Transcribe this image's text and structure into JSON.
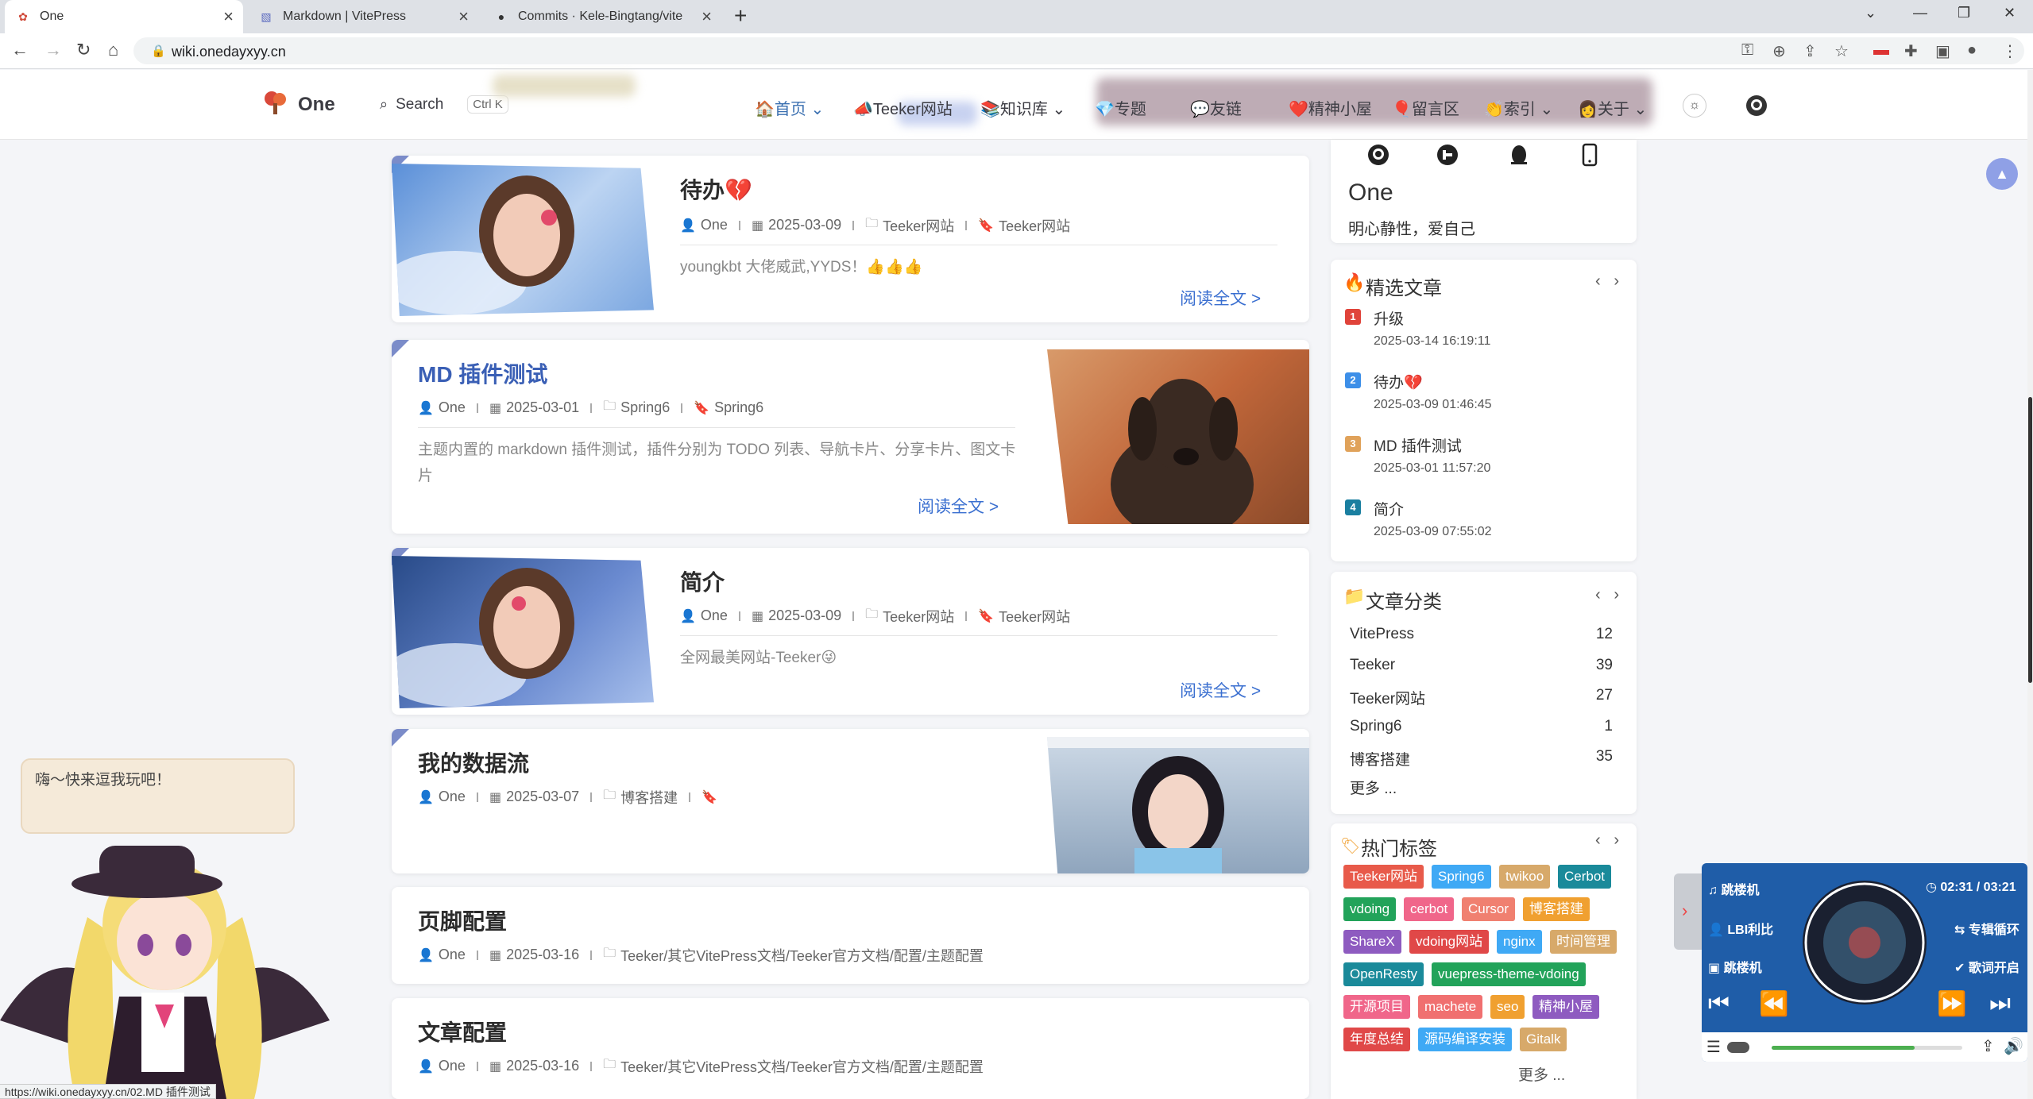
{
  "browser": {
    "tabs": [
      {
        "title": "One",
        "active": true
      },
      {
        "title": "Markdown | VitePress",
        "active": false
      },
      {
        "title": "Commits · Kele-Bingtang/vite",
        "active": false
      }
    ],
    "url": "wiki.onedayxyy.cn",
    "status_url": "https://wiki.onedayxyy.cn/02.MD 插件测试"
  },
  "header": {
    "site_name": "One",
    "search_label": "Search",
    "search_shortcut": "Ctrl K",
    "nav": [
      "首页",
      "Teeker网站",
      "知识库",
      "专题",
      "友链",
      "精神小屋",
      "留言区",
      "索引",
      "关于"
    ]
  },
  "posts": [
    {
      "title": "待办💔",
      "author": "One",
      "date": "2025-03-09",
      "category": "Teeker网站",
      "tag": "Teeker网站",
      "excerpt": "youngkbt 大佬威武,YYDS！👍👍👍",
      "read_more": "阅读全文 >"
    },
    {
      "title": "MD 插件测试",
      "author": "One",
      "date": "2025-03-01",
      "category": "Spring6",
      "tag": "Spring6",
      "excerpt": "主题内置的 markdown 插件测试，插件分别为 TODO 列表、导航卡片、分享卡片、图文卡片",
      "read_more": "阅读全文 >"
    },
    {
      "title": "简介",
      "author": "One",
      "date": "2025-03-09",
      "category": "Teeker网站",
      "tag": "Teeker网站",
      "excerpt": "全网最美网站-Teeker😜",
      "read_more": "阅读全文 >"
    },
    {
      "title": "我的数据流",
      "author": "One",
      "date": "2025-03-07",
      "category": "博客搭建",
      "tag": ""
    },
    {
      "title": "页脚配置",
      "author": "One",
      "date": "2025-03-16",
      "category": "Teeker/其它VitePress文档/Teeker官方文档/配置/主题配置"
    },
    {
      "title": "文章配置",
      "author": "One",
      "date": "2025-03-16",
      "category": "Teeker/其它VitePress文档/Teeker官方文档/配置/主题配置"
    }
  ],
  "profile": {
    "name": "One",
    "motto": "明心静性，爱自己"
  },
  "featured": {
    "title": "精选文章",
    "items": [
      {
        "rank": "1",
        "title": "升级",
        "date": "2025-03-14 16:19:11",
        "color": "#e0433a"
      },
      {
        "rank": "2",
        "title": "待办💔",
        "date": "2025-03-09 01:46:45",
        "color": "#3d8fe8"
      },
      {
        "rank": "3",
        "title": "MD 插件测试",
        "date": "2025-03-01 11:57:20",
        "color": "#e0a25a"
      },
      {
        "rank": "4",
        "title": "简介",
        "date": "2025-03-09 07:55:02",
        "color": "#1a7fa0"
      }
    ]
  },
  "categories": {
    "title": "文章分类",
    "items": [
      {
        "name": "VitePress",
        "count": "12"
      },
      {
        "name": "Teeker",
        "count": "39"
      },
      {
        "name": "Teeker网站",
        "count": "27"
      },
      {
        "name": "Spring6",
        "count": "1"
      },
      {
        "name": "博客搭建",
        "count": "35"
      }
    ],
    "more": "更多 ..."
  },
  "tags": {
    "title": "热门标签",
    "items": [
      {
        "name": "Teeker网站",
        "color": "#e85a4a"
      },
      {
        "name": "Spring6",
        "color": "#3fa9f5"
      },
      {
        "name": "twikoo",
        "color": "#d7a96a"
      },
      {
        "name": "Cerbot",
        "color": "#1a8a9a"
      },
      {
        "name": "vdoing",
        "color": "#22a35a"
      },
      {
        "name": "cerbot",
        "color": "#f0668a"
      },
      {
        "name": "Cursor",
        "color": "#f08070"
      },
      {
        "name": "博客搭建",
        "color": "#f0a030"
      },
      {
        "name": "ShareX",
        "color": "#8e5bc0"
      },
      {
        "name": "vdoing网站",
        "color": "#e04848"
      },
      {
        "name": "nginx",
        "color": "#3fa9f5"
      },
      {
        "name": "时间管理",
        "color": "#d7a96a"
      },
      {
        "name": "OpenResty",
        "color": "#1a8a9a"
      },
      {
        "name": "vuepress-theme-vdoing",
        "color": "#22a35a"
      },
      {
        "name": "开源项目",
        "color": "#f0668a"
      },
      {
        "name": "machete",
        "color": "#f07070"
      },
      {
        "name": "seo",
        "color": "#f0a030"
      },
      {
        "name": "精神小屋",
        "color": "#8e5bc0"
      },
      {
        "name": "年度总结",
        "color": "#e04848"
      },
      {
        "name": "源码编译安装",
        "color": "#3fa9f5"
      },
      {
        "name": "Gitalk",
        "color": "#d7a96a"
      }
    ],
    "more": "更多 ..."
  },
  "live2d": {
    "greeting": "嗨～快来逗我玩吧！"
  },
  "player": {
    "song": "跳楼机",
    "artist": "LBI利比",
    "album": "跳楼机",
    "time": "02:31 / 03:21",
    "mode": "专辑循环",
    "lyrics": "歌词开启",
    "progress": 0.75
  }
}
